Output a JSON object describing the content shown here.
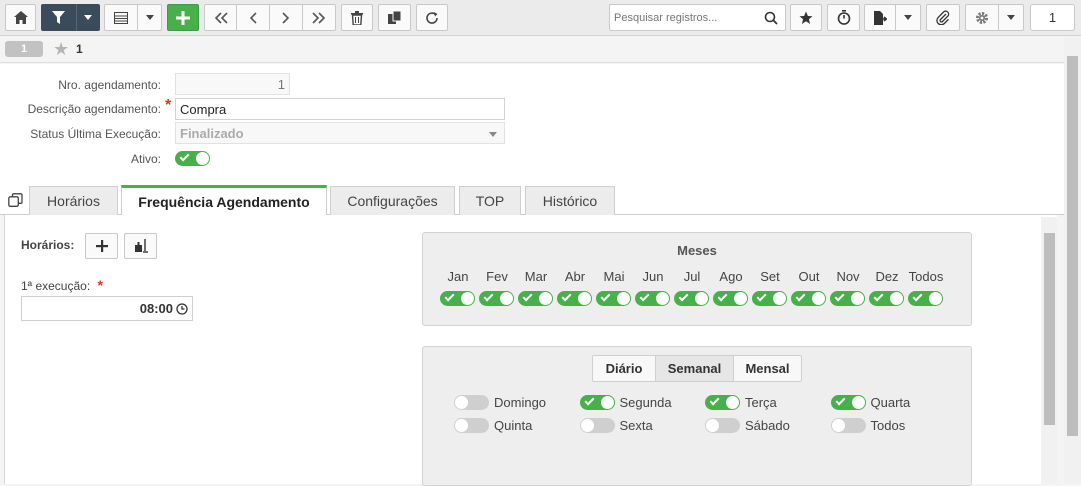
{
  "toolbar": {
    "search_placeholder": "Pesquisar registros...",
    "page_number": "1"
  },
  "record": {
    "badge": "1",
    "number": "1"
  },
  "form": {
    "nro_label": "Nro. agendamento:",
    "nro_value": "1",
    "descricao_label": "Descrição agendamento:",
    "descricao_value": "Compra",
    "status_label": "Status Última Execução:",
    "status_value": "Finalizado",
    "ativo_label": "Ativo:",
    "ativo_on": true
  },
  "tabs": [
    "Horários",
    "Frequência Agendamento",
    "Configurações",
    "TOP",
    "Histórico"
  ],
  "active_tab": "Frequência Agendamento",
  "horarios": {
    "label": "Horários:",
    "primeira_label": "1ª execução:",
    "primeira_value": "08:00"
  },
  "meses": {
    "title": "Meses",
    "items": [
      {
        "label": "Jan",
        "on": true
      },
      {
        "label": "Fev",
        "on": true
      },
      {
        "label": "Mar",
        "on": true
      },
      {
        "label": "Abr",
        "on": true
      },
      {
        "label": "Mai",
        "on": true
      },
      {
        "label": "Jun",
        "on": true
      },
      {
        "label": "Jul",
        "on": true
      },
      {
        "label": "Ago",
        "on": true
      },
      {
        "label": "Set",
        "on": true
      },
      {
        "label": "Out",
        "on": true
      },
      {
        "label": "Nov",
        "on": true
      },
      {
        "label": "Dez",
        "on": true
      },
      {
        "label": "Todos",
        "on": true
      }
    ]
  },
  "frequencia": {
    "options": [
      "Diário",
      "Semanal",
      "Mensal"
    ],
    "selected": "Semanal",
    "dias": [
      {
        "label": "Domingo",
        "on": false
      },
      {
        "label": "Segunda",
        "on": true
      },
      {
        "label": "Terça",
        "on": true
      },
      {
        "label": "Quarta",
        "on": true
      },
      {
        "label": "Quinta",
        "on": false
      },
      {
        "label": "Sexta",
        "on": false
      },
      {
        "label": "Sábado",
        "on": false
      },
      {
        "label": "Todos",
        "on": false
      }
    ]
  },
  "colors": {
    "accent_green": "#47b04b",
    "dark_button": "#3b4b5c"
  }
}
